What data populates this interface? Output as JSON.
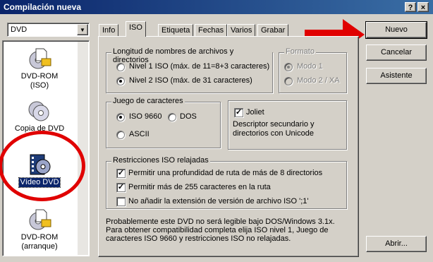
{
  "window": {
    "title": "Compilación nueva",
    "help": "?",
    "close": "×"
  },
  "drive_select": {
    "value": "DVD"
  },
  "compilation_types": [
    {
      "label_line1": "DVD-ROM",
      "label_line2": "(ISO)",
      "icon": "dvd-rom-iso-icon"
    },
    {
      "label_line1": "Copia de DVD",
      "label_line2": "",
      "icon": "dvd-copy-icon"
    },
    {
      "label_line1": "Vídeo DVD",
      "label_line2": "",
      "icon": "video-dvd-icon",
      "selected": true
    },
    {
      "label_line1": "DVD-ROM",
      "label_line2": "(arranque)",
      "icon": "dvd-rom-boot-icon"
    }
  ],
  "tabs": [
    "Info",
    "ISO",
    "Etiqueta",
    "Fechas",
    "Varios",
    "Grabar"
  ],
  "active_tab": "ISO",
  "iso": {
    "name_length": {
      "legend": "Longitud de nombres de archivos y directorios",
      "level1": "Nivel 1 ISO (máx. de 11=8+3 caracteres)",
      "level2": "Nivel 2 ISO (máx. de 31 caracteres)",
      "selected": "level2"
    },
    "format": {
      "legend": "Formato",
      "mode1": "Modo 1",
      "mode2": "Modo 2 / XA",
      "selected": "mode1",
      "disabled": true
    },
    "charset": {
      "legend": "Juego de caracteres",
      "iso9660": "ISO 9660",
      "dos": "DOS",
      "ascii": "ASCII",
      "selected": "iso9660"
    },
    "joliet": {
      "label": "Joliet",
      "checked": true,
      "description_line1": "Descriptor secundario y",
      "description_line2": "directorios con Unicode"
    },
    "relaxations": {
      "legend": "Restricciones ISO relajadas",
      "opt1": "Permitir una profundidad de ruta de más de 8 directorios",
      "opt2": "Permitir más de 255 caracteres en la ruta",
      "opt3": "No añadir la extensión de versión de archivo ISO ';1'",
      "opt1_checked": true,
      "opt2_checked": true,
      "opt3_checked": false
    },
    "note_line1": "Probablemente este DVD no será legible bajo DOS/Windows 3.1x.",
    "note_line2": "Para obtener compatibilidad completa elija ISO nivel 1, Juego de",
    "note_line3": "caracteres ISO 9660 y restricciones ISO no relajadas."
  },
  "buttons": {
    "new": "Nuevo",
    "cancel": "Cancelar",
    "wizard": "Asistente",
    "open": "Abrir..."
  },
  "annotation_colors": {
    "circle": "#e00000",
    "arrow": "#e00000"
  }
}
